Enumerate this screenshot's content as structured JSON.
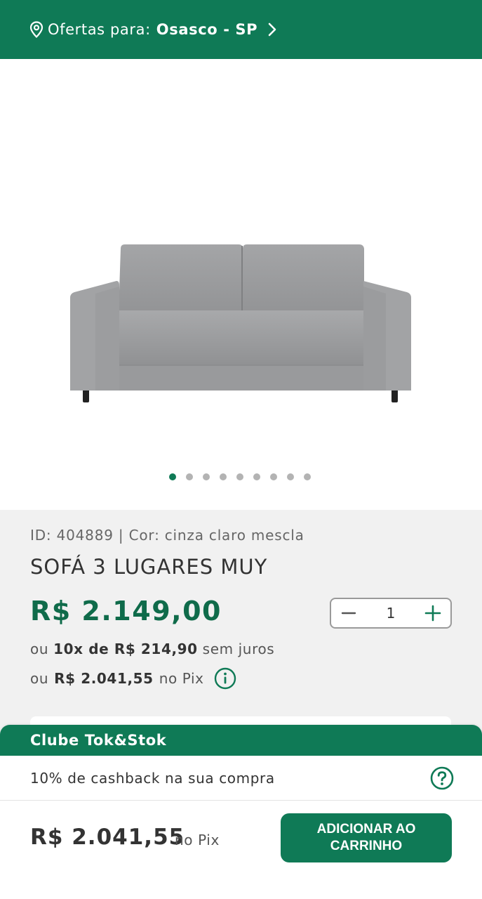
{
  "header": {
    "location_label": "Ofertas para:",
    "location_value": "Osasco - SP"
  },
  "gallery": {
    "image_alt": "SOFÁ 3 LUGARES MUY",
    "dot_count": 9,
    "active_index": 0
  },
  "product": {
    "meta": "ID: 404889 | Cor: cinza claro mescla",
    "title": "SOFÁ 3 LUGARES MUY",
    "price": "R$ 2.149,00",
    "installment_prefix": "ou",
    "installment_bold": "10x de R$ 214,90",
    "installment_suffix": "sem juros",
    "pix_prefix": "ou",
    "pix_bold": "R$ 2.041,55",
    "pix_suffix": "no Pix",
    "quantity": "1"
  },
  "clube": {
    "title": "Clube Tok&Stok",
    "text": "10% de cashback na sua compra"
  },
  "footer": {
    "price": "R$ 2.041,55",
    "price_suffix": "no Pix",
    "cart_button": "ADICIONAR AO\nCARRINHO"
  },
  "colors": {
    "brand_green": "#0f7a56",
    "price_green": "#0f6b4a",
    "panel_gray": "#f1f1f1"
  }
}
